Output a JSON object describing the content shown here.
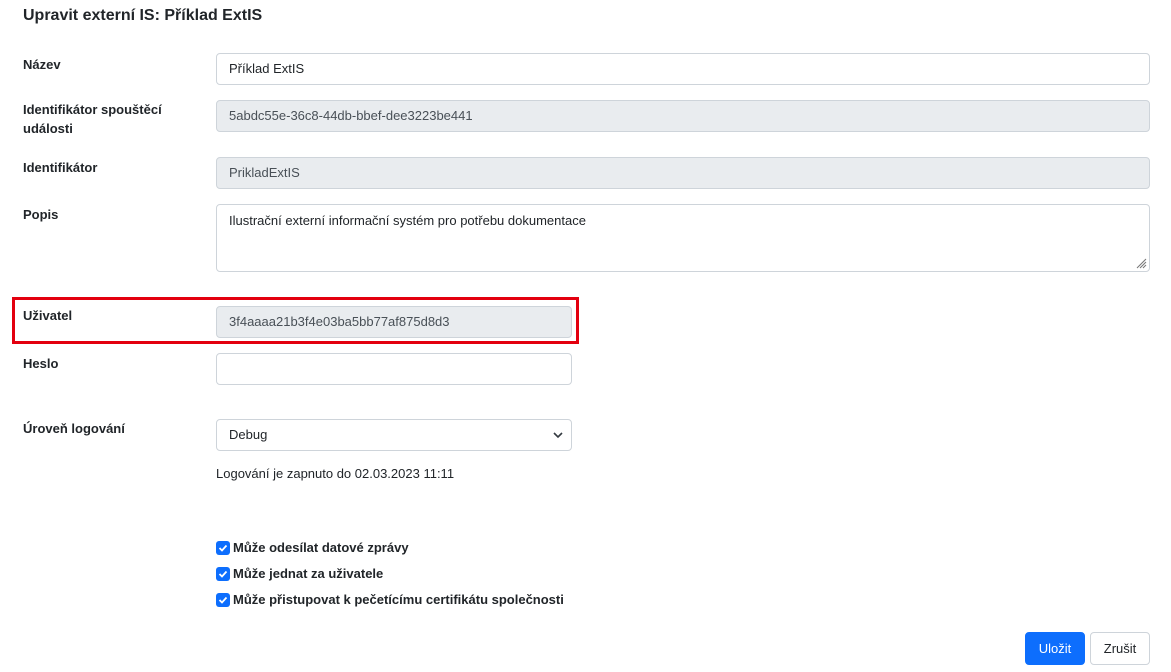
{
  "page": {
    "title": "Upravit externí IS: Příklad ExtIS"
  },
  "form": {
    "name": {
      "label": "Název",
      "value": "Příklad ExtIS"
    },
    "trigger_id": {
      "label": "Identifikátor spouštěcí události",
      "value": "5abdc55e-36c8-44db-bbef-dee3223be441"
    },
    "identifier": {
      "label": "Identifikátor",
      "value": "PrikladExtIS"
    },
    "description": {
      "label": "Popis",
      "value": "Ilustrační externí informační systém pro potřebu dokumentace"
    },
    "user": {
      "label": "Uživatel",
      "value": "3f4aaaa21b3f4e03ba5bb77af875d8d3"
    },
    "password": {
      "label": "Heslo",
      "value": ""
    },
    "log_level": {
      "label": "Úroveň logování",
      "value": "Debug"
    },
    "logging_info": "Logování je zapnuto do 02.03.2023 11:11",
    "checkboxes": [
      {
        "label": "Může odesílat datové zprávy",
        "checked": true
      },
      {
        "label": "Může jednat za uživatele",
        "checked": true
      },
      {
        "label": "Může přistupovat k pečetícímu certifikátu společnosti",
        "checked": true
      }
    ]
  },
  "buttons": {
    "save": "Uložit",
    "cancel": "Zrušit"
  },
  "colors": {
    "primary": "#0d6efd",
    "highlight": "#e3000f",
    "readonly_bg": "#e9ecef"
  }
}
